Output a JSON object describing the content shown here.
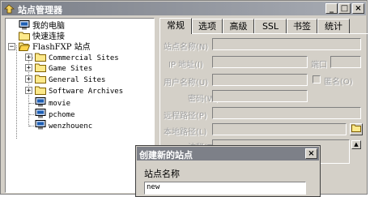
{
  "window": {
    "title": "站点管理器",
    "min_glyph": "_",
    "max_glyph": "□",
    "close_glyph": "×"
  },
  "tree": {
    "my_computer": "我的电脑",
    "quick_connect": "快速连接",
    "flashfxp_sites": "FlashFXP 站点",
    "folders": [
      "Commercial Sites",
      "Game Sites",
      "General Sites",
      "Software Archives"
    ],
    "sites": [
      "movie",
      "pchome",
      "wenzhouenc"
    ],
    "expand_glyph": "+",
    "collapse_glyph": "−"
  },
  "tabs": [
    "常规",
    "选项",
    "高级",
    "SSL",
    "书签",
    "统计"
  ],
  "form": {
    "site_name": "站点名称(N)",
    "ip_address": "IP 地址(I)",
    "port": "端口",
    "username": "用户名称(U)",
    "anonymous": "匿名(O)",
    "password": "密码(W)",
    "remote_path": "远程路径(P)",
    "local_path": "本地路径(L)",
    "notes": "注释(T)"
  },
  "dialog": {
    "title": "创建新的站点",
    "close_glyph": "×",
    "label": "站点名称",
    "value": "new"
  }
}
